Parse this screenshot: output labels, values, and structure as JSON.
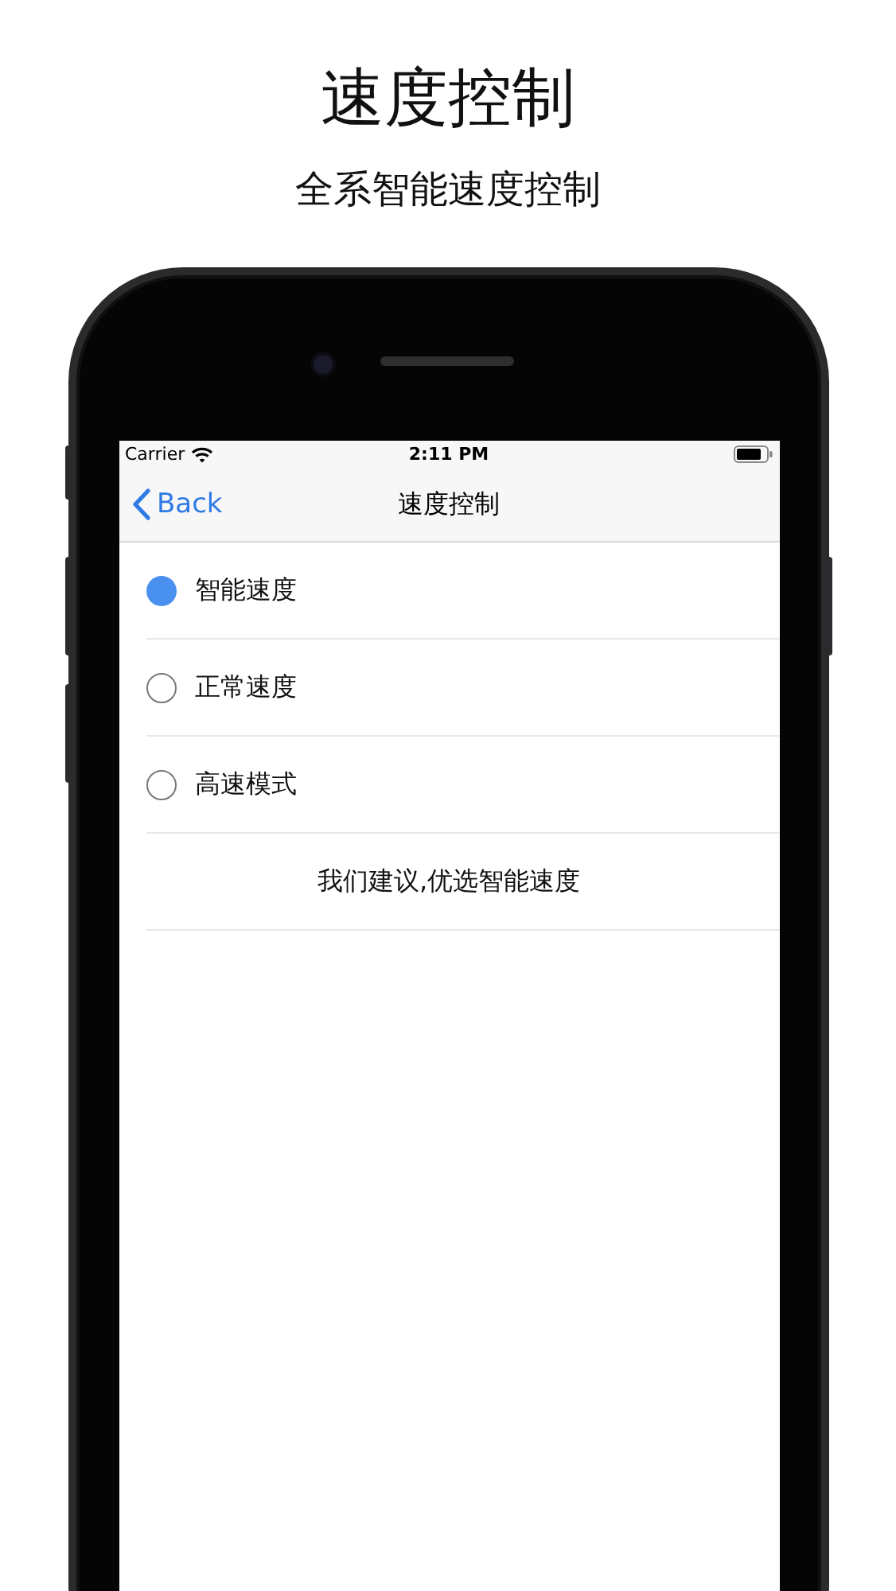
{
  "header": {
    "title": "速度控制",
    "subtitle": "全系智能速度控制"
  },
  "status_bar": {
    "carrier": "Carrier",
    "time": "2:11 PM"
  },
  "nav_bar": {
    "back": "Back",
    "title": "速度控制"
  },
  "options": [
    {
      "label": "智能速度",
      "selected": true
    },
    {
      "label": "正常速度",
      "selected": false
    },
    {
      "label": "高速模式",
      "selected": false
    }
  ],
  "note": "我们建议,优选智能速度"
}
